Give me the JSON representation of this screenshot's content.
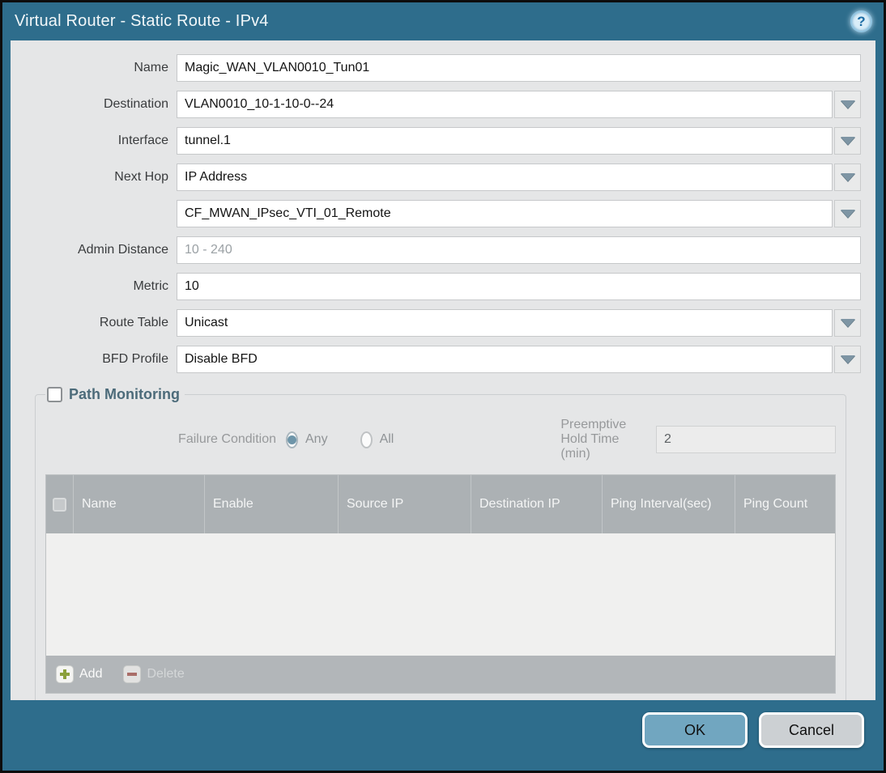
{
  "dialog": {
    "title": "Virtual Router - Static Route - IPv4",
    "help_icon": "?"
  },
  "form": {
    "fields": [
      {
        "label": "Name",
        "value": "Magic_WAN_VLAN0010_Tun01",
        "type": "text"
      },
      {
        "label": "Destination",
        "value": "VLAN0010_10-1-10-0--24",
        "type": "dropdown"
      },
      {
        "label": "Interface",
        "value": "tunnel.1",
        "type": "dropdown"
      },
      {
        "label": "Next Hop",
        "value": "IP Address",
        "type": "dropdown"
      },
      {
        "label": "",
        "value": "CF_MWAN_IPsec_VTI_01_Remote",
        "type": "dropdown"
      },
      {
        "label": "Admin Distance",
        "value": "",
        "placeholder": "10 - 240",
        "type": "text"
      },
      {
        "label": "Metric",
        "value": "10",
        "type": "text"
      },
      {
        "label": "Route Table",
        "value": "Unicast",
        "type": "dropdown"
      },
      {
        "label": "BFD Profile",
        "value": "Disable BFD",
        "type": "dropdown"
      }
    ]
  },
  "path_monitoring": {
    "title": "Path Monitoring",
    "checkbox_checked": false,
    "failure_condition_label": "Failure Condition",
    "radio_any": "Any",
    "radio_all": "All",
    "selected_radio": "Any",
    "hold_time_label": "Preemptive Hold Time (min)",
    "hold_time_value": "2",
    "table": {
      "columns": [
        "Name",
        "Enable",
        "Source IP",
        "Destination IP",
        "Ping Interval(sec)",
        "Ping Count"
      ],
      "rows": []
    },
    "toolbar": {
      "add_label": "Add",
      "delete_label": "Delete"
    }
  },
  "footer": {
    "ok_label": "OK",
    "cancel_label": "Cancel"
  },
  "colors": {
    "chrome_teal": "#2e6d8c",
    "content_bg": "#e5e6e7",
    "table_header_bg": "#acb1b4",
    "table_toolbar_bg": "#b2b6b9",
    "ok_button_bg": "#71a6c0",
    "cancel_button_bg": "#ccd0d3",
    "pm_title_color": "#4c6b7a",
    "add_icon_green": "#8ba03c",
    "delete_icon_red": "#a85c55",
    "radio_selected_dot": "#6e95a9"
  }
}
